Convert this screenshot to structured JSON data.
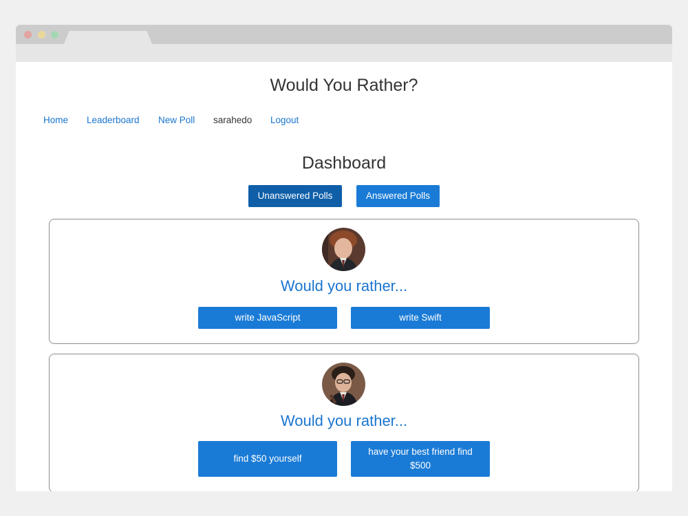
{
  "app": {
    "title": "Would You Rather?"
  },
  "nav": {
    "items": [
      {
        "label": "Home"
      },
      {
        "label": "Leaderboard"
      },
      {
        "label": "New Poll"
      },
      {
        "label": "sarahedo"
      },
      {
        "label": "Logout"
      }
    ]
  },
  "dashboard": {
    "title": "Dashboard",
    "tabs": [
      {
        "label": "Unanswered Polls",
        "active": true
      },
      {
        "label": "Answered Polls",
        "active": false
      }
    ]
  },
  "polls": [
    {
      "heading": "Would you rather...",
      "avatar": "ron-weasley-avatar",
      "options": [
        "write JavaScript",
        "write Swift"
      ]
    },
    {
      "heading": "Would you rather...",
      "avatar": "harry-potter-avatar",
      "options": [
        "find $50 yourself",
        "have your best friend find $500"
      ]
    }
  ],
  "colors": {
    "link": "#1a75cf",
    "button": "#1a7bd6",
    "button_active": "#0e5ea8"
  }
}
